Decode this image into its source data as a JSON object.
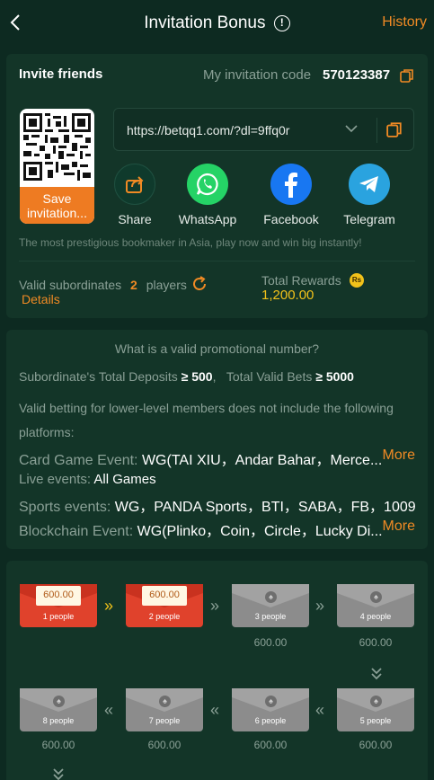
{
  "header": {
    "title": "Invitation Bonus",
    "info_glyph": "!",
    "history_label": "History"
  },
  "invite": {
    "title": "Invite friends",
    "code_label": "My invitation code",
    "code_value": "570123387",
    "save_label": "Save invitation...",
    "link": "https://betqq1.com/?dl=9ffq0r",
    "share_items": [
      {
        "label": "Share",
        "icon": "share-icon",
        "color": "#0f3a2c"
      },
      {
        "label": "WhatsApp",
        "icon": "whatsapp-icon",
        "color": "#25d366"
      },
      {
        "label": "Facebook",
        "icon": "facebook-icon",
        "color": "#1877f2"
      },
      {
        "label": "Telegram",
        "icon": "telegram-icon",
        "color": "#2aa3df"
      }
    ],
    "slogan": "The most prestigious bookmaker in Asia, play now and win big instantly!",
    "subordinates_label": "Valid subordinates",
    "subordinates_count": "2",
    "subordinates_unit": "players",
    "details_label": "Details",
    "rewards_label": "Total Rewards",
    "currency_badge": "Rs",
    "rewards_value": "1,200.00"
  },
  "rules": {
    "title": "What is a valid promotional number?",
    "deposits_label": "Subordinate's Total Deposits",
    "deposits_op": "≥",
    "deposits_value": "500",
    "bets_label": "Total Valid Bets",
    "bets_op": "≥",
    "bets_value": "5000",
    "exclusion_line1": "Valid betting for lower-level members does not include the following",
    "exclusion_line2": "platforms:",
    "card_label": "Card Game Event:",
    "card_value": "WG(TAI XIU，Andar Bahar，Merce...",
    "live_label": "Live events:",
    "live_value": "All Games",
    "sports_label": "Sports events:",
    "sports_value": "WG，PANDA Sports，BTI，SABA，FB，1009",
    "blockchain_label": "Blockchain Event:",
    "blockchain_value": "WG(Plinko，Coin，Circle，Lucky Di...",
    "more_label": "More"
  },
  "rewards_track": [
    {
      "people": "1 people",
      "amount": "600.00",
      "claimed": true
    },
    {
      "people": "2 people",
      "amount": "600.00",
      "claimed": true
    },
    {
      "people": "3 people",
      "amount": "600.00",
      "claimed": false
    },
    {
      "people": "4 people",
      "amount": "600.00",
      "claimed": false
    },
    {
      "people": "5 people",
      "amount": "600.00",
      "claimed": false
    },
    {
      "people": "6 people",
      "amount": "600.00",
      "claimed": false
    },
    {
      "people": "7 people",
      "amount": "600.00",
      "claimed": false
    },
    {
      "people": "8 people",
      "amount": "600.00",
      "claimed": false
    }
  ],
  "colors": {
    "accent": "#f08a24",
    "gold": "#f2c21a",
    "background": "#0d2a21",
    "card": "#133528"
  }
}
